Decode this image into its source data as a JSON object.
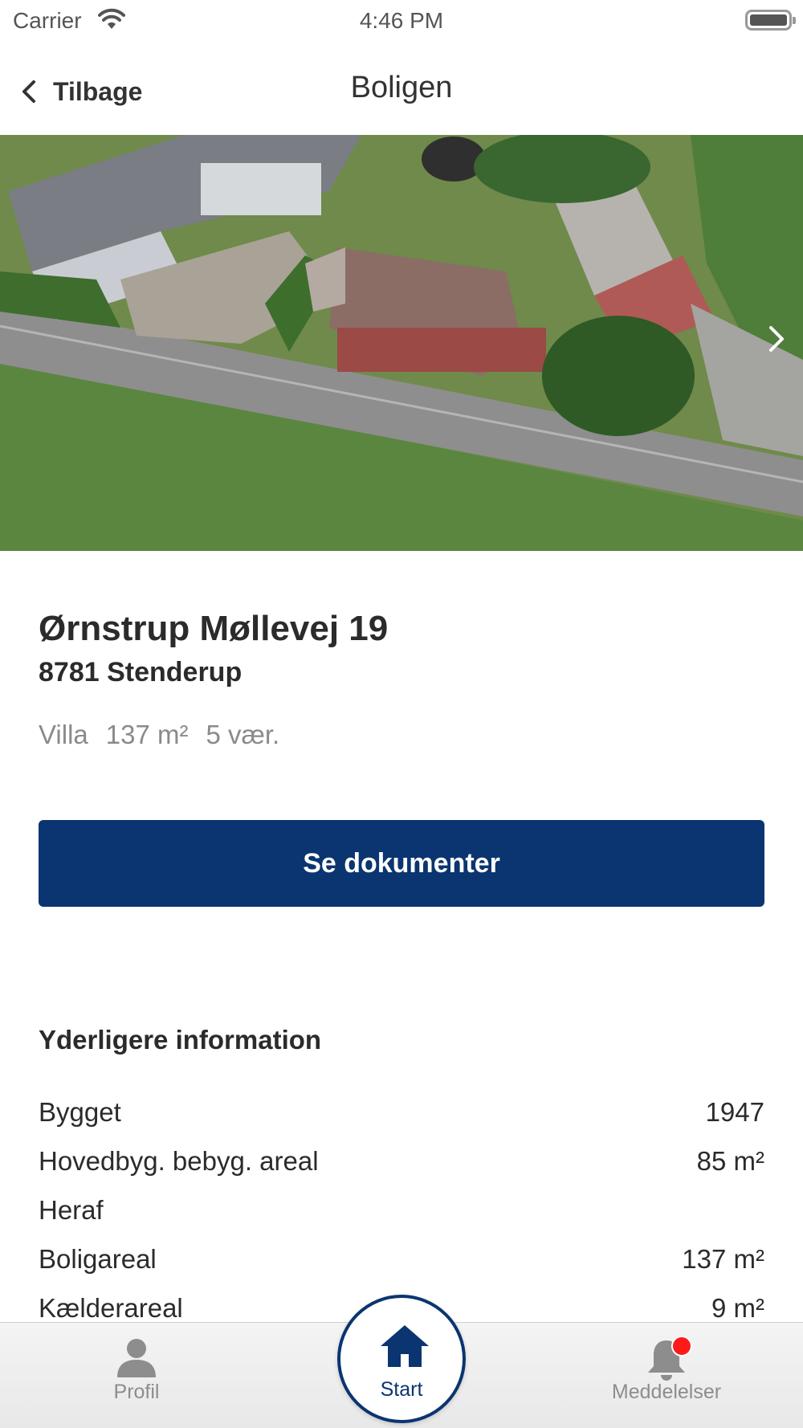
{
  "status_bar": {
    "carrier": "Carrier",
    "time": "4:46 PM"
  },
  "nav": {
    "back_label": "Tilbage",
    "title": "Boligen"
  },
  "hero": {
    "image": "aerial-house-photo",
    "next_icon": "chevron-right-icon"
  },
  "property": {
    "street": "Ørnstrup Møllevej 19",
    "city": "8781 Stenderup",
    "specs": [
      "Villa",
      "137 m²",
      "5 vær."
    ]
  },
  "cta": {
    "label": "Se dokumenter"
  },
  "info": {
    "heading": "Yderligere information",
    "rows": [
      {
        "label": "Bygget",
        "value": "1947"
      },
      {
        "label": "Hovedbyg. bebyg. areal",
        "value": "85 m²"
      },
      {
        "label": "Heraf",
        "value": ""
      },
      {
        "label": "Boligareal",
        "value": "137 m²"
      },
      {
        "label": "Kælderareal",
        "value": "9 m²"
      }
    ]
  },
  "tabs": {
    "profil": {
      "label": "Profil",
      "icon": "person-icon"
    },
    "start": {
      "label": "Start",
      "icon": "home-icon"
    },
    "notifications": {
      "label": "Meddelelser",
      "icon": "bell-icon"
    }
  },
  "colors": {
    "primary": "#0a3570",
    "badge": "#ff1a1a",
    "muted_text": "#8a8a8a"
  }
}
